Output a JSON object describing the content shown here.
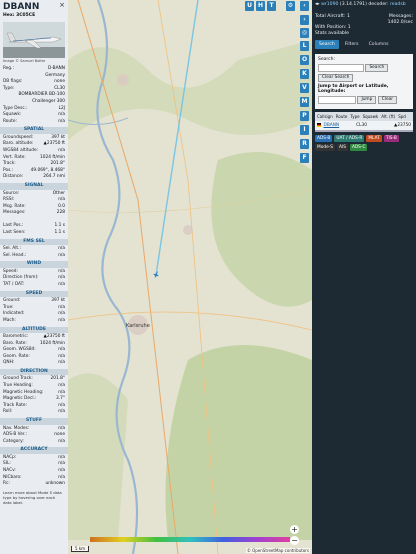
{
  "left": {
    "registration": "DBANN",
    "hex_label": "Hex:",
    "hex": "3C05CE",
    "close_symbol": "×",
    "photo_credit": "Image © Samuel Bolter",
    "info": [
      {
        "k": "Reg.:",
        "v": "D-BANN"
      },
      {
        "k": "",
        "v": "Germany"
      },
      {
        "k": "DB flags:",
        "v": "none"
      },
      {
        "k": "Type:",
        "v": "CL30"
      },
      {
        "k": "",
        "v": "BOMBARDIER BD-100"
      },
      {
        "k": "",
        "v": "Challenger 300"
      },
      {
        "k": "Type Desc.:",
        "v": "L2J"
      },
      {
        "k": "Squawk:",
        "v": "n/a"
      },
      {
        "k": "Route:",
        "v": "n/a"
      }
    ],
    "sections": [
      {
        "title": "SPATIAL",
        "rows": [
          {
            "k": "Groundspeed:",
            "v": "397 kt"
          },
          {
            "k": "Baro. altitude:",
            "v": "▲23750 ft"
          },
          {
            "k": "WGS84 altitude:",
            "v": "n/a"
          },
          {
            "k": "Vert. Rate:",
            "v": "1024 ft/min"
          },
          {
            "k": "Track:",
            "v": "201.8°"
          },
          {
            "k": "Pos.:",
            "v": "49.069°, 8.468°"
          },
          {
            "k": "Distance:",
            "v": "264.7 nmi"
          }
        ]
      },
      {
        "title": "SIGNAL",
        "rows": [
          {
            "k": "Source:",
            "v": "Other"
          },
          {
            "k": "RSSI:",
            "v": "n/a"
          },
          {
            "k": "Msg. Rate:",
            "v": "0.0"
          },
          {
            "k": "Messages:",
            "v": "228"
          },
          {
            "k": "",
            "v": ""
          },
          {
            "k": "Last Pos.:",
            "v": "1.1 s"
          },
          {
            "k": "Last Seen:",
            "v": "1.1 s"
          }
        ]
      },
      {
        "title": "FMS SEL",
        "rows": [
          {
            "k": "Sel. Alt.:",
            "v": "n/a"
          },
          {
            "k": "Sel. Head.:",
            "v": "n/a"
          }
        ]
      },
      {
        "title": "WIND",
        "rows": [
          {
            "k": "Speed:",
            "v": "n/a"
          },
          {
            "k": "Direction (from):",
            "v": "n/a"
          },
          {
            "k": "TAT / OAT:",
            "v": "n/a"
          }
        ]
      },
      {
        "title": "SPEED",
        "rows": [
          {
            "k": "Ground:",
            "v": "397 kt"
          },
          {
            "k": "True:",
            "v": "n/a"
          },
          {
            "k": "Indicated:",
            "v": "n/a"
          },
          {
            "k": "Mach:",
            "v": "n/a"
          }
        ]
      },
      {
        "title": "ALTITUDE",
        "rows": [
          {
            "k": "Barometric:",
            "v": "▲23750 ft"
          },
          {
            "k": "Baro. Rate:",
            "v": "1024 ft/min"
          },
          {
            "k": "Geom. WGS84:",
            "v": "n/a"
          },
          {
            "k": "Geom. Rate:",
            "v": "n/a"
          },
          {
            "k": "QNH:",
            "v": "n/a"
          }
        ]
      },
      {
        "title": "DIRECTION",
        "rows": [
          {
            "k": "Ground Track:",
            "v": "201.8°"
          },
          {
            "k": "True Heading:",
            "v": "n/a"
          },
          {
            "k": "Magnetic Heading:",
            "v": "n/a"
          },
          {
            "k": "Magnetic Decl.:",
            "v": "3.7°"
          },
          {
            "k": "Track Rate:",
            "v": "n/a"
          },
          {
            "k": "Roll:",
            "v": "n/a"
          }
        ]
      },
      {
        "title": "STUFF",
        "rows": [
          {
            "k": "Nav. Modes:",
            "v": "n/a"
          },
          {
            "k": "ADS-B Ver.:",
            "v": "none"
          },
          {
            "k": "Category:",
            "v": "n/a"
          }
        ]
      },
      {
        "title": "ACCURACY",
        "rows": [
          {
            "k": "NACp:",
            "v": "n/a"
          },
          {
            "k": "SIL:",
            "v": "n/a"
          },
          {
            "k": "NACv:",
            "v": "n/a"
          },
          {
            "k": "NICbaro:",
            "v": "n/a"
          },
          {
            "k": "Rc:",
            "v": "unknown"
          }
        ]
      }
    ],
    "learn_text": "Learn more about Mode S data type by hovering over each data label."
  },
  "map": {
    "buttons_top": [
      "U",
      "H",
      "T"
    ],
    "side_buttons": [
      "L",
      "O",
      "K",
      "V",
      "M",
      "P",
      "I",
      "R",
      "F"
    ],
    "city_labels": [
      "Karlsruhe"
    ],
    "scale_label": "5 km",
    "attribution": "© OpenStreetMap contributors",
    "altitude_ticks": [
      "2000",
      "4000",
      "6000",
      "10000",
      "20000",
      "30000",
      "40000 ft"
    ],
    "zoom_in": "+",
    "zoom_out": "−"
  },
  "right": {
    "top_link": "wr1090",
    "top_version": "(3.14.1791) decoder:",
    "top_readsb": "readsb",
    "total_aircraft_label": "Total Aircraft: 1",
    "messages_label": "Messages:",
    "messages_value": "1402.0/sec",
    "with_position": "With Position: 1",
    "stats_available": "Stats available",
    "tabs": [
      "Search",
      "Filters",
      "Columns"
    ],
    "search_label": "Search:",
    "search_button": "Search",
    "clear_search_button": "Clear Search",
    "jump_label": "Jump to Airport or Latitude, Longitude:",
    "jump_button": "Jump",
    "clear_button": "Clear",
    "columns": [
      "Callsign",
      "Route",
      "Type",
      "Squawk",
      "Alt. (ft)",
      "Spd"
    ],
    "aircraft_row": {
      "callsign": "DBANN",
      "type": "CL30",
      "alt": "▲23750"
    },
    "tags": [
      "ADS-B",
      "UAT / ADS-R",
      "MLAT",
      "TIS-B",
      "Mode-S",
      "AIS",
      "ADS-C"
    ],
    "tag_colors": [
      "#2a6fb0",
      "#2f7a70",
      "#c24a1f",
      "#9a2c7c",
      "#333333",
      "#333333",
      "#2f8a3f"
    ]
  }
}
